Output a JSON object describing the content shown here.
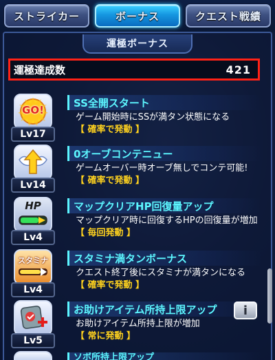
{
  "tabs": [
    {
      "label": "ストライカー",
      "active": false
    },
    {
      "label": "ボーナス",
      "active": true
    },
    {
      "label": "クエスト戦績",
      "active": false
    }
  ],
  "section_title": "運極ボーナス",
  "summary": {
    "label": "運極達成数",
    "value": "421"
  },
  "items": [
    {
      "icon": "go-badge-icon",
      "icon_text": "GO!",
      "level": "Lv17",
      "title": "SS全開スタート",
      "description": "ゲーム開始時にSSが満タン状態になる",
      "note": "【 確率で発動 】"
    },
    {
      "icon": "winged-arrow-icon",
      "level": "Lv14",
      "title": "0オーブコンテニュー",
      "description": "ゲームオーバー時オーブ無しでコンテ可能!",
      "note": "【 確率で発動 】"
    },
    {
      "icon": "hp-gauge-icon",
      "icon_text": "HP",
      "level": "Lv4",
      "title": "マップクリアHP回復量アップ",
      "description": "マップクリア時に回復するHPの回復量が増加",
      "note": "【 毎回発動 】"
    },
    {
      "icon": "stamina-gauge-icon",
      "icon_text": "スタミナ",
      "level": "Lv4",
      "title": "スタミナ満タンボーナス",
      "description": "クエスト終了後にスタミナが満タンになる",
      "note": "【 確率で発動 】"
    },
    {
      "icon": "item-plus-icon",
      "level": "Lv5",
      "title": "お助けアイテム所持上限アップ",
      "description": "お助けアイテム所持上限が増加",
      "note": "【 常に発動 】",
      "info_button": "i"
    }
  ],
  "peek_item": {
    "title": "ソボ所持上限アップ"
  },
  "colors": {
    "accent": "#5cf6ff",
    "note": "#ffd21e",
    "highlight_border": "#ff2216",
    "active_tab": "#1596e0"
  }
}
